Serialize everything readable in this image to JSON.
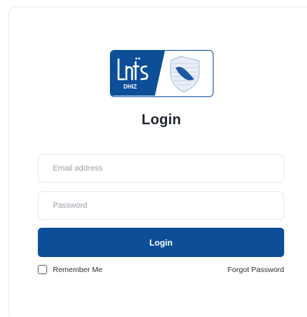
{
  "logo": {
    "text_main": "Lnts",
    "text_sub": "DHIZ"
  },
  "form": {
    "title": "Login",
    "email_placeholder": "Email address",
    "password_placeholder": "Password",
    "login_button": "Login",
    "remember_label": "Remember Me",
    "forgot_link": "Forgot Password"
  },
  "colors": {
    "primary": "#0c4f98",
    "text": "#1f2430",
    "border": "#e5e7ee"
  },
  "icons": [
    "brand-logo",
    "shield-icon",
    "checkbox"
  ]
}
